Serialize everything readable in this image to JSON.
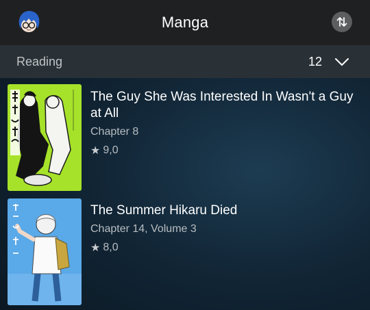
{
  "header": {
    "title": "Manga",
    "avatar_icon": "user-avatar-icon",
    "sort_icon": "sort-arrows-icon"
  },
  "section": {
    "label": "Reading",
    "count": "12",
    "toggle_icon": "chevron-down-icon"
  },
  "items": [
    {
      "title": "The Guy She Was Interested In Wasn't a Guy at All",
      "chapter": "Chapter 8",
      "rating": "9,0",
      "cover_accent": "#a6e22a"
    },
    {
      "title": "The Summer Hikaru Died",
      "chapter": "Chapter 14, Volume 3",
      "rating": "8,0",
      "cover_accent": "#5aa9e8"
    }
  ],
  "colors": {
    "header_bg": "#1f2021",
    "section_bg": "#2a3136",
    "secondary_text": "#b9bdc1"
  }
}
